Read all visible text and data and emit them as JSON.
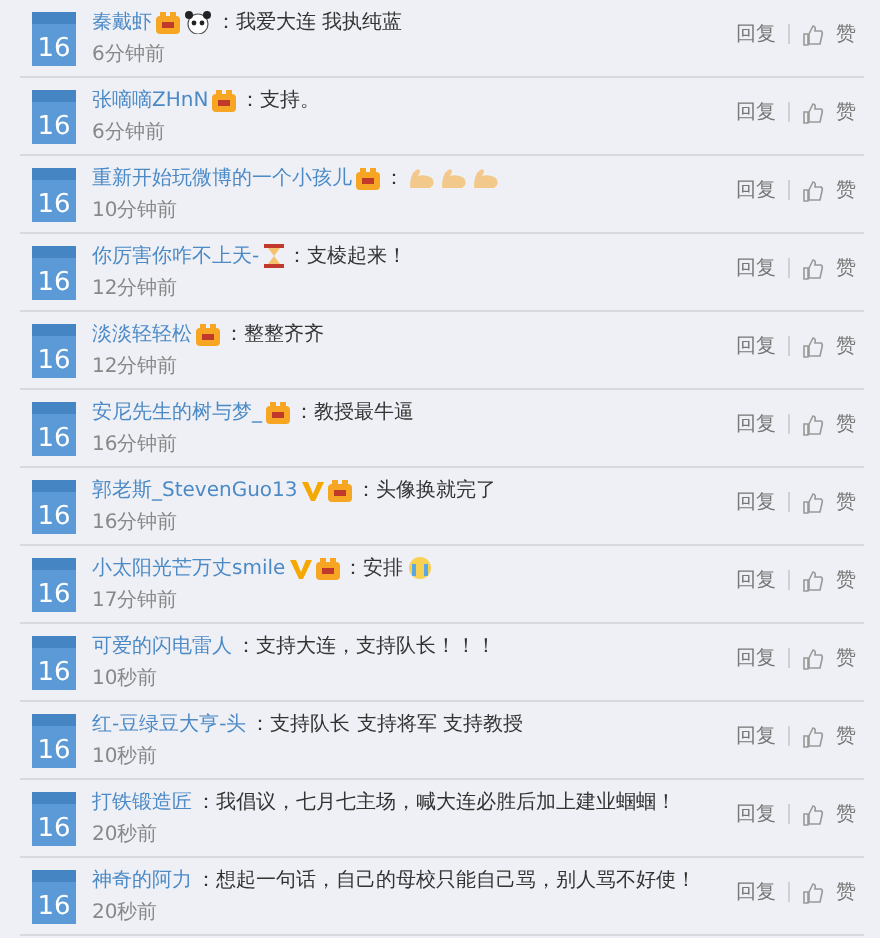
{
  "comments": [
    {
      "avatar": "16",
      "name": "秦戴虾",
      "badges": [
        {
          "kind": "member"
        },
        {
          "kind": "panda"
        }
      ],
      "text": "：我爱大连 我执纯蓝",
      "time": "6分钟前",
      "reply": "回复",
      "like": "赞"
    },
    {
      "avatar": "16",
      "name": "张嘀嘀ZHnN",
      "badges": [
        {
          "kind": "member"
        }
      ],
      "text": "：支持。",
      "time": "6分钟前",
      "reply": "回复",
      "like": "赞"
    },
    {
      "avatar": "16",
      "name": "重新开始玩微博的一个小孩儿",
      "badges": [
        {
          "kind": "member"
        }
      ],
      "text": "：",
      "emojis": [
        {
          "kind": "muscle"
        },
        {
          "kind": "muscle"
        },
        {
          "kind": "muscle"
        }
      ],
      "time": "10分钟前",
      "reply": "回复",
      "like": "赞"
    },
    {
      "avatar": "16",
      "name": "你厉害你咋不上天-",
      "badges": [
        {
          "kind": "hourglass"
        }
      ],
      "text": "：支棱起来！",
      "time": "12分钟前",
      "reply": "回复",
      "like": "赞"
    },
    {
      "avatar": "16",
      "name": "淡淡轻轻松",
      "badges": [
        {
          "kind": "member"
        }
      ],
      "text": "：整整齐齐",
      "time": "12分钟前",
      "reply": "回复",
      "like": "赞"
    },
    {
      "avatar": "16",
      "name": "安尼先生的树与梦_",
      "badges": [
        {
          "kind": "member"
        }
      ],
      "text": "：教授最牛逼",
      "time": "16分钟前",
      "reply": "回复",
      "like": "赞"
    },
    {
      "avatar": "16",
      "name": "郭老斯_StevenGuo13",
      "badges": [
        {
          "kind": "verified"
        },
        {
          "kind": "member"
        }
      ],
      "text": "：头像换就完了",
      "time": "16分钟前",
      "reply": "回复",
      "like": "赞"
    },
    {
      "avatar": "16",
      "name": "小太阳光芒万丈smile",
      "badges": [
        {
          "kind": "verified"
        },
        {
          "kind": "member"
        }
      ],
      "text": "：安排",
      "emojis": [
        {
          "kind": "crying"
        }
      ],
      "time": "17分钟前",
      "reply": "回复",
      "like": "赞"
    },
    {
      "avatar": "16",
      "name": "可爱的闪电雷人",
      "text": "：支持大连，支持队长！！！",
      "time": "10秒前",
      "reply": "回复",
      "like": "赞"
    },
    {
      "avatar": "16",
      "name": "红-豆绿豆大亨-头",
      "text": "：支持队长 支持将军 支持教授",
      "time": "10秒前",
      "reply": "回复",
      "like": "赞"
    },
    {
      "avatar": "16",
      "name": "打铁锻造匠",
      "text": "：我倡议，七月七主场，喊大连必胜后加上建业蝈蝈！",
      "time": "20秒前",
      "reply": "回复",
      "like": "赞"
    },
    {
      "avatar": "16",
      "name": "神奇的阿力",
      "text": "：想起一句话，自己的母校只能自己骂，别人骂不好使！",
      "time": "20秒前",
      "reply": "回复",
      "like": "赞"
    }
  ]
}
